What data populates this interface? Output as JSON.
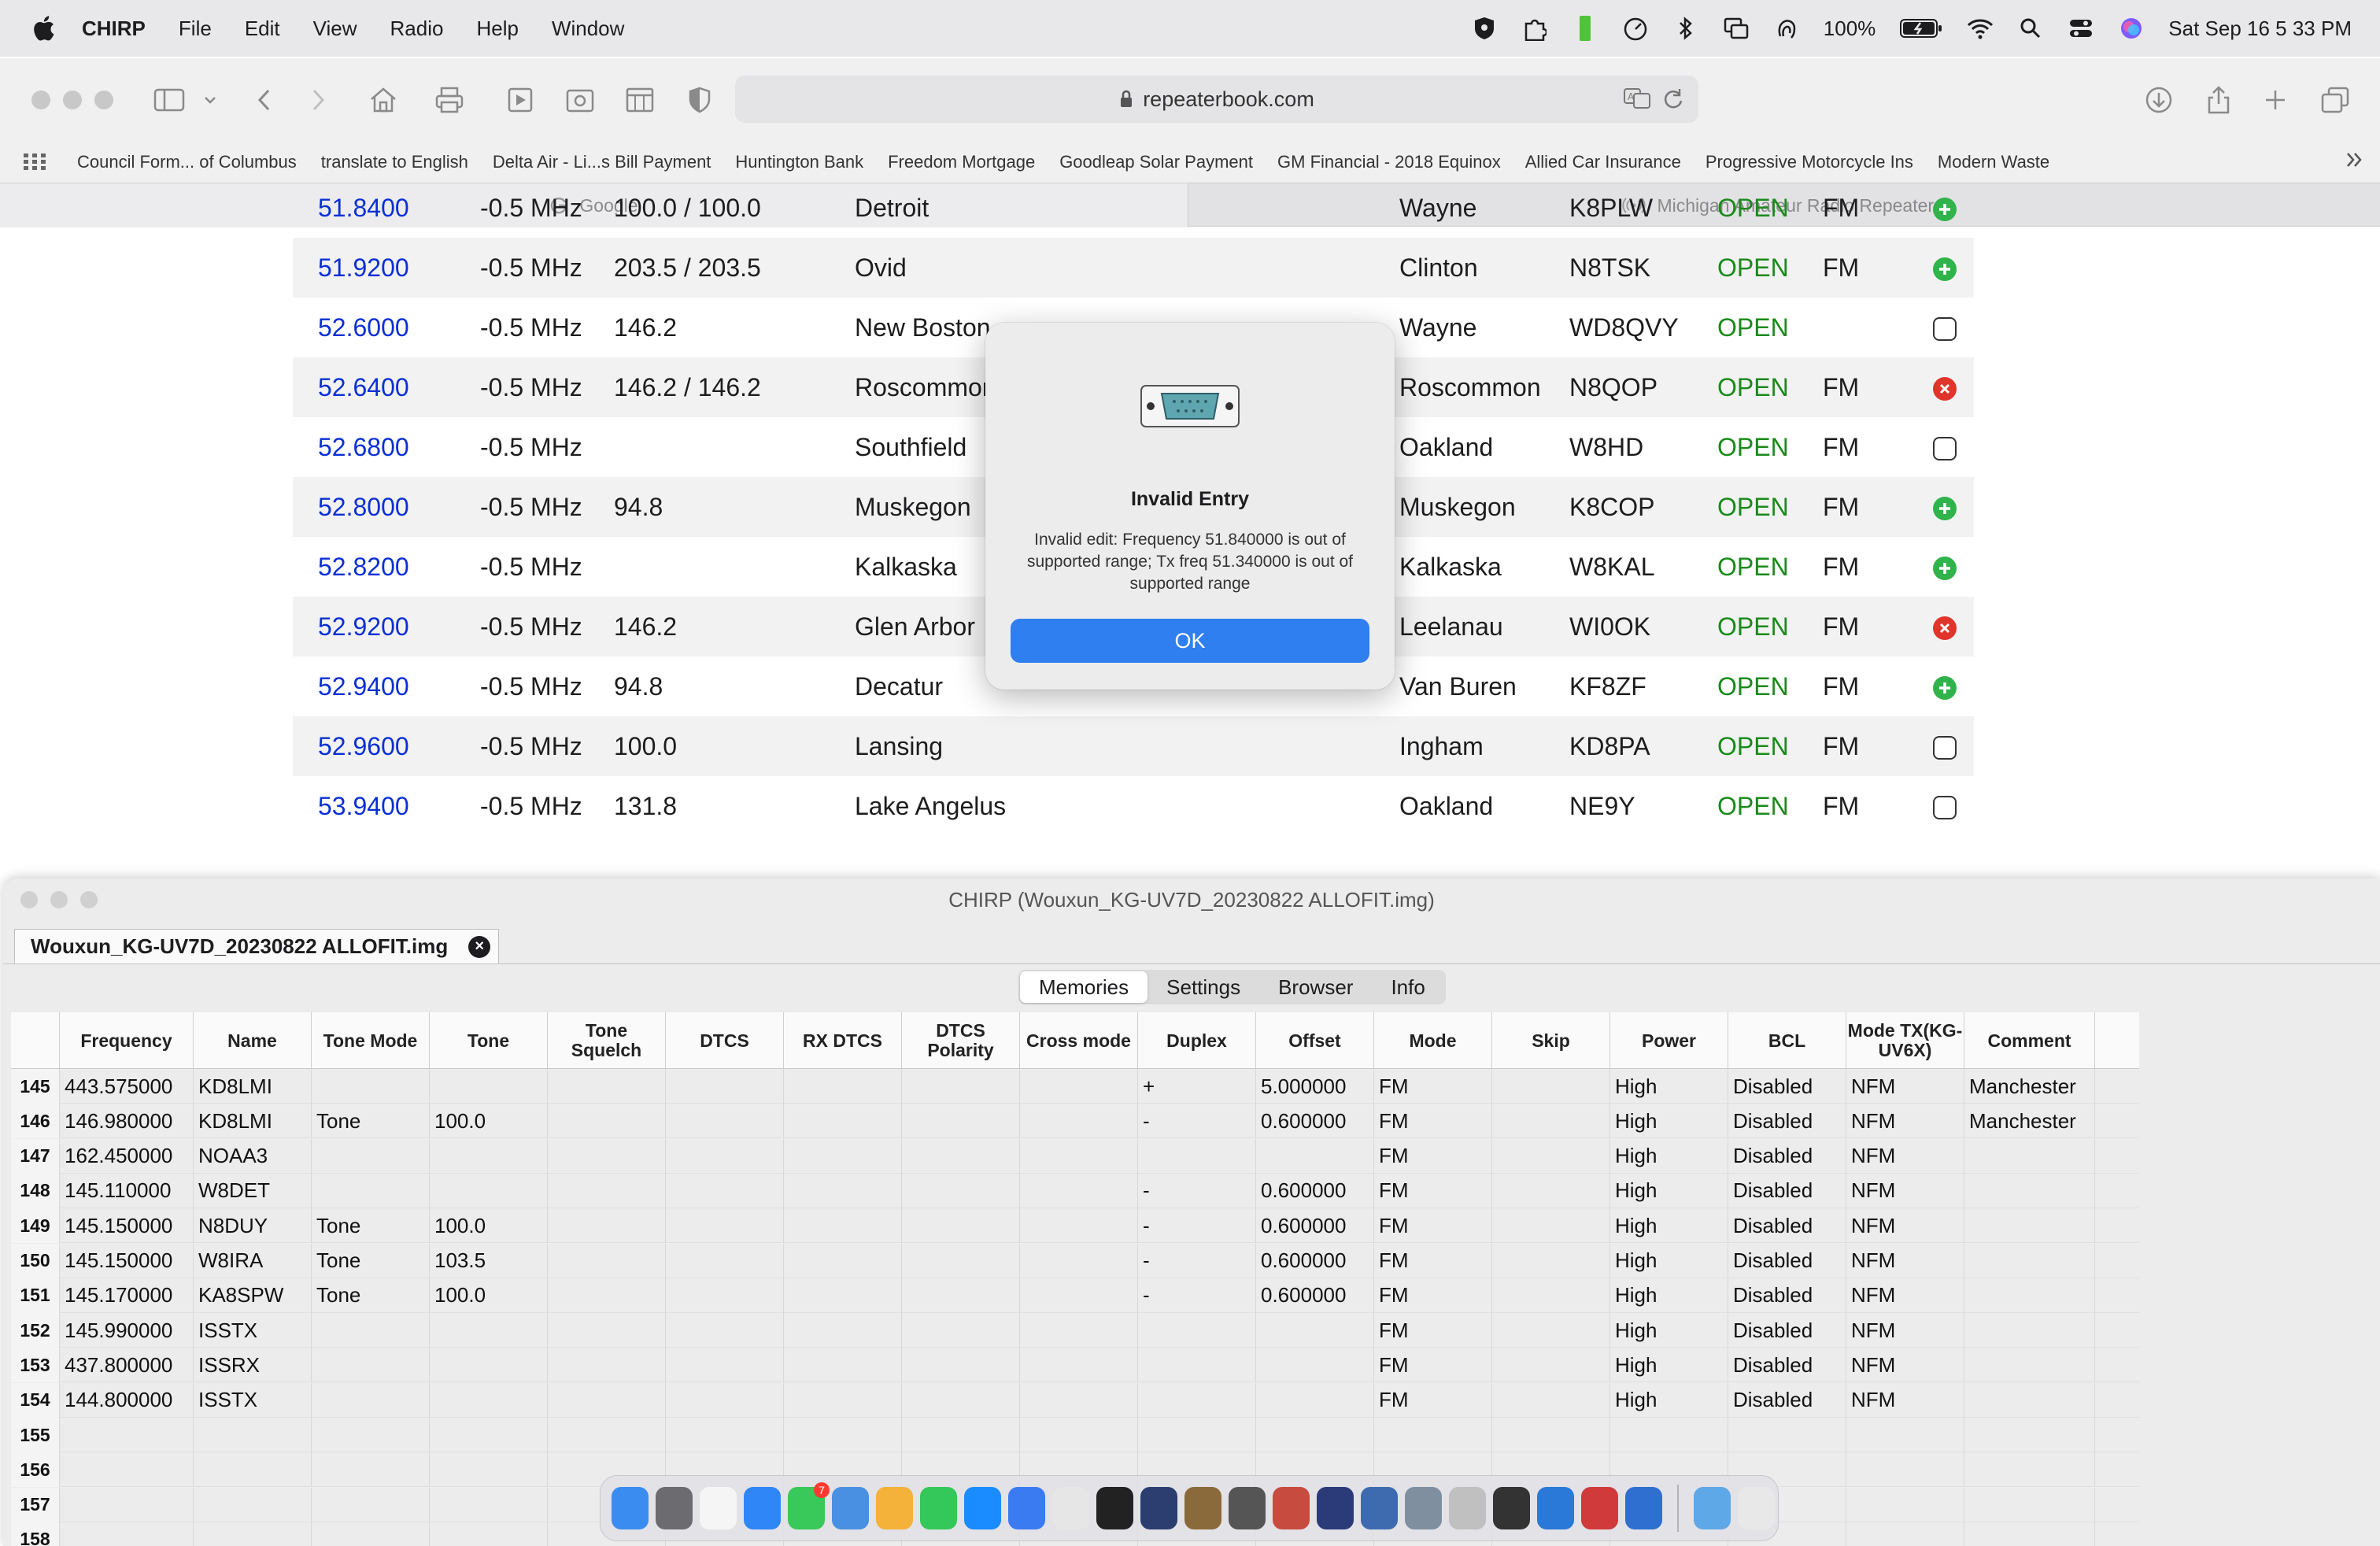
{
  "menubar": {
    "app_name": "CHIRP",
    "menus": [
      "File",
      "Edit",
      "View",
      "Radio",
      "Help",
      "Window"
    ],
    "battery": "100%",
    "clock": "Sat Sep 16  5 33 PM"
  },
  "safari": {
    "url": "repeaterbook.com",
    "favorites": [
      "Council Form... of Columbus",
      "translate to English",
      "Delta Air - Li...s Bill Payment",
      "Huntington Bank",
      "Freedom Mortgage",
      "Goodleap Solar Payment",
      "GM Financial - 2018 Equinox",
      "Allied Car Insurance",
      "Progressive Motorcycle Ins",
      "Modern Waste"
    ],
    "tabs": [
      "Google",
      "Michigan Amateur Radio Repeaters"
    ]
  },
  "repeaters": [
    {
      "freq": "51.8400",
      "offset": "-0.5 MHz",
      "tone": "100.0 / 100.0",
      "city": "Detroit",
      "county": "Wayne",
      "call": "K8PLW",
      "status": "OPEN",
      "mode": "FM",
      "indicator": "green"
    },
    {
      "freq": "51.9200",
      "offset": "-0.5 MHz",
      "tone": "203.5 / 203.5",
      "city": "Ovid",
      "county": "Clinton",
      "call": "N8TSK",
      "status": "OPEN",
      "mode": "FM",
      "indicator": "green"
    },
    {
      "freq": "52.6000",
      "offset": "-0.5 MHz",
      "tone": "146.2",
      "city": "New Boston",
      "county": "Wayne",
      "call": "WD8QVY",
      "status": "OPEN",
      "mode": "",
      "indicator": "empty"
    },
    {
      "freq": "52.6400",
      "offset": "-0.5 MHz",
      "tone": "146.2 / 146.2",
      "city": "Roscommon",
      "county": "Roscommon",
      "call": "N8QOP",
      "status": "OPEN",
      "mode": "FM",
      "indicator": "red"
    },
    {
      "freq": "52.6800",
      "offset": "-0.5 MHz",
      "tone": "",
      "city": "Southfield",
      "county": "Oakland",
      "call": "W8HD",
      "status": "OPEN",
      "mode": "FM",
      "indicator": "empty"
    },
    {
      "freq": "52.8000",
      "offset": "-0.5 MHz",
      "tone": "94.8",
      "city": "Muskegon",
      "county": "Muskegon",
      "call": "K8COP",
      "status": "OPEN",
      "mode": "FM",
      "indicator": "green"
    },
    {
      "freq": "52.8200",
      "offset": "-0.5 MHz",
      "tone": "",
      "city": "Kalkaska",
      "county": "Kalkaska",
      "call": "W8KAL",
      "status": "OPEN",
      "mode": "FM",
      "indicator": "green"
    },
    {
      "freq": "52.9200",
      "offset": "-0.5 MHz",
      "tone": "146.2",
      "city": "Glen Arbor",
      "county": "Leelanau",
      "call": "WI0OK",
      "status": "OPEN",
      "mode": "FM",
      "indicator": "red"
    },
    {
      "freq": "52.9400",
      "offset": "-0.5 MHz",
      "tone": "94.8",
      "city": "Decatur",
      "county": "Van Buren",
      "call": "KF8ZF",
      "status": "OPEN",
      "mode": "FM",
      "indicator": "green"
    },
    {
      "freq": "52.9600",
      "offset": "-0.5 MHz",
      "tone": "100.0",
      "city": "Lansing",
      "county": "Ingham",
      "call": "KD8PA",
      "status": "OPEN",
      "mode": "FM",
      "indicator": "empty"
    },
    {
      "freq": "53.9400",
      "offset": "-0.5 MHz",
      "tone": "131.8",
      "city": "Lake Angelus",
      "county": "Oakland",
      "call": "NE9Y",
      "status": "OPEN",
      "mode": "FM",
      "indicator": "empty"
    }
  ],
  "alert": {
    "title": "Invalid Entry",
    "message": "Invalid edit: Frequency 51.840000 is out of supported range; Tx freq 51.340000 is out of supported range",
    "ok_label": "OK"
  },
  "chirp": {
    "window_title": "CHIRP (Wouxun_KG-UV7D_20230822 ALLOFIT.img)",
    "file_tab": "Wouxun_KG-UV7D_20230822 ALLOFIT.img",
    "view_tabs": [
      "Memories",
      "Settings",
      "Browser",
      "Info"
    ],
    "active_tab": "Memories",
    "columns": [
      "Frequency",
      "Name",
      "Tone Mode",
      "Tone",
      "Tone Squelch",
      "DTCS",
      "RX DTCS",
      "DTCS Polarity",
      "Cross mode",
      "Duplex",
      "Offset",
      "Mode",
      "Skip",
      "Power",
      "BCL",
      "Mode TX(KG-UV6X)",
      "Comment"
    ],
    "rows": [
      {
        "num": "145",
        "cells": [
          "443.575000",
          "KD8LMI",
          "",
          "",
          "",
          "",
          "",
          "",
          "",
          "+",
          "5.000000",
          "FM",
          "",
          "High",
          "Disabled",
          "NFM",
          "Manchester"
        ]
      },
      {
        "num": "146",
        "cells": [
          "146.980000",
          "KD8LMI",
          "Tone",
          "100.0",
          "",
          "",
          "",
          "",
          "",
          "-",
          "0.600000",
          "FM",
          "",
          "High",
          "Disabled",
          "NFM",
          "Manchester"
        ]
      },
      {
        "num": "147",
        "cells": [
          "162.450000",
          "NOAA3",
          "",
          "",
          "",
          "",
          "",
          "",
          "",
          "",
          "",
          "FM",
          "",
          "High",
          "Disabled",
          "NFM",
          ""
        ]
      },
      {
        "num": "148",
        "cells": [
          "145.110000",
          "W8DET",
          "",
          "",
          "",
          "",
          "",
          "",
          "",
          "-",
          "0.600000",
          "FM",
          "",
          "High",
          "Disabled",
          "NFM",
          ""
        ]
      },
      {
        "num": "149",
        "cells": [
          "145.150000",
          "N8DUY",
          "Tone",
          "100.0",
          "",
          "",
          "",
          "",
          "",
          "-",
          "0.600000",
          "FM",
          "",
          "High",
          "Disabled",
          "NFM",
          ""
        ]
      },
      {
        "num": "150",
        "cells": [
          "145.150000",
          "W8IRA",
          "Tone",
          "103.5",
          "",
          "",
          "",
          "",
          "",
          "-",
          "0.600000",
          "FM",
          "",
          "High",
          "Disabled",
          "NFM",
          ""
        ]
      },
      {
        "num": "151",
        "cells": [
          "145.170000",
          "KA8SPW",
          "Tone",
          "100.0",
          "",
          "",
          "",
          "",
          "",
          "-",
          "0.600000",
          "FM",
          "",
          "High",
          "Disabled",
          "NFM",
          ""
        ]
      },
      {
        "num": "152",
        "cells": [
          "145.990000",
          "ISSTX",
          "",
          "",
          "",
          "",
          "",
          "",
          "",
          "",
          "",
          "FM",
          "",
          "High",
          "Disabled",
          "NFM",
          ""
        ]
      },
      {
        "num": "153",
        "cells": [
          "437.800000",
          "ISSRX",
          "",
          "",
          "",
          "",
          "",
          "",
          "",
          "",
          "",
          "FM",
          "",
          "High",
          "Disabled",
          "NFM",
          ""
        ]
      },
      {
        "num": "154",
        "cells": [
          "144.800000",
          "ISSTX",
          "",
          "",
          "",
          "",
          "",
          "",
          "",
          "",
          "",
          "FM",
          "",
          "High",
          "Disabled",
          "NFM",
          ""
        ]
      },
      {
        "num": "155",
        "cells": [
          "",
          "",
          "",
          "",
          "",
          "",
          "",
          "",
          "",
          "",
          "",
          "",
          "",
          "",
          "",
          "",
          ""
        ]
      },
      {
        "num": "156",
        "cells": [
          "",
          "",
          "",
          "",
          "",
          "",
          "",
          "",
          "",
          "",
          "",
          "",
          "",
          "",
          "",
          "",
          ""
        ]
      },
      {
        "num": "157",
        "cells": [
          "",
          "",
          "",
          "",
          "",
          "",
          "",
          "",
          "",
          "",
          "",
          "",
          "",
          "",
          "",
          "",
          ""
        ]
      },
      {
        "num": "158",
        "cells": [
          "",
          "",
          "",
          "",
          "",
          "",
          "",
          "",
          "",
          "",
          "",
          "",
          "",
          "",
          "",
          "",
          ""
        ]
      }
    ]
  },
  "dock": {
    "apps": [
      "finder-icon",
      "system-settings-icon",
      "textedit-icon",
      "safari-icon",
      "messages-icon",
      "mail-icon",
      "photos-icon",
      "facetime-icon",
      "app-store-icon",
      "signal-icon",
      "preview-icon",
      "unity-icon",
      "chirp-app-icon",
      "cassette-icon",
      "calculator-icon",
      "flashcards-icon",
      "weather-icon",
      "radio-app-icon",
      "serial-app-icon",
      "scanner-icon",
      "usb-drive-icon",
      "windows-app-icon",
      "parallels-icon",
      "xcode-icon",
      "downloads-folder-icon",
      "trash-icon"
    ],
    "message_badge": "7"
  },
  "colors": {
    "link_blue": "#0b2fd6",
    "open_green": "#1a8a1a",
    "alert_button": "#2f7ff0"
  }
}
